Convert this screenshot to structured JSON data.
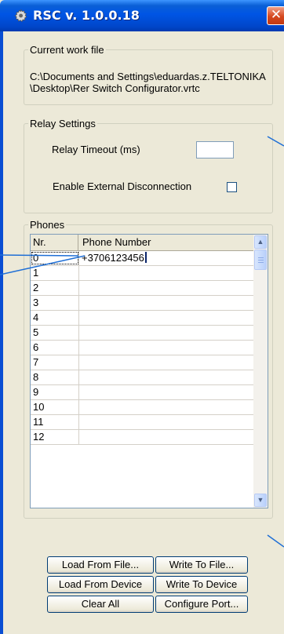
{
  "window": {
    "title": "RSC  v. 1.0.0.18",
    "close_glyph": "✕"
  },
  "work_file": {
    "legend": "Current work file",
    "path": "C:\\Documents and Settings\\eduardas.z.TELTONIKA\\Desktop\\Rer Switch Configurator.vrtc"
  },
  "relay": {
    "legend": "Relay Settings",
    "timeout_label": "Relay Timeout (ms)",
    "timeout_value": "",
    "external_label": "Enable External Disconnection",
    "external_checked": false
  },
  "phones": {
    "legend": "Phones",
    "col_nr": "Nr.",
    "col_phone": "Phone Number",
    "rows": [
      {
        "nr": "0",
        "phone": "+3706123456"
      },
      {
        "nr": "1",
        "phone": ""
      },
      {
        "nr": "2",
        "phone": ""
      },
      {
        "nr": "3",
        "phone": ""
      },
      {
        "nr": "4",
        "phone": ""
      },
      {
        "nr": "5",
        "phone": ""
      },
      {
        "nr": "6",
        "phone": ""
      },
      {
        "nr": "7",
        "phone": ""
      },
      {
        "nr": "8",
        "phone": ""
      },
      {
        "nr": "9",
        "phone": ""
      },
      {
        "nr": "10",
        "phone": ""
      },
      {
        "nr": "11",
        "phone": ""
      },
      {
        "nr": "12",
        "phone": ""
      }
    ]
  },
  "buttons": {
    "load_file": "Load From File...",
    "write_file": "Write To File...",
    "load_device": "Load From Device",
    "write_device": "Write To Device",
    "clear_all": "Clear All",
    "configure_port": "Configure Port..."
  },
  "icons": {
    "app": "gear-icon",
    "scroll_up": "arrow-up-icon",
    "scroll_down": "arrow-down-icon"
  },
  "colors": {
    "titlebar": "#0055e5",
    "window_bg": "#ece9d8",
    "close_button": "#d5471e",
    "callout_line": "#1f6fd6"
  }
}
